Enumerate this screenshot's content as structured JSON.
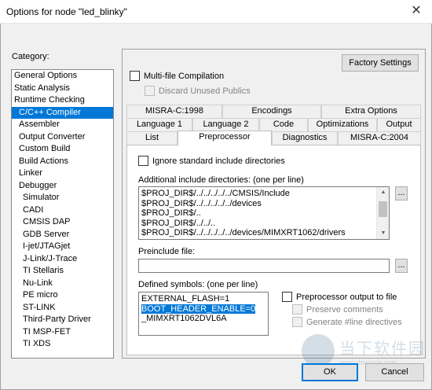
{
  "window": {
    "title": "Options for node \"led_blinky\"",
    "close_glyph": "✕"
  },
  "category": {
    "label": "Category:",
    "items": [
      {
        "label": "General Options"
      },
      {
        "label": "Static Analysis"
      },
      {
        "label": "Runtime Checking"
      },
      {
        "label": "C/C++ Compiler"
      },
      {
        "label": "Assembler"
      },
      {
        "label": "Output Converter"
      },
      {
        "label": "Custom Build"
      },
      {
        "label": "Build Actions"
      },
      {
        "label": "Linker"
      },
      {
        "label": "Debugger"
      },
      {
        "label": "Simulator"
      },
      {
        "label": "CADI"
      },
      {
        "label": "CMSIS DAP"
      },
      {
        "label": "GDB Server"
      },
      {
        "label": "I-jet/JTAGjet"
      },
      {
        "label": "J-Link/J-Trace"
      },
      {
        "label": "TI Stellaris"
      },
      {
        "label": "Nu-Link"
      },
      {
        "label": "PE micro"
      },
      {
        "label": "ST-LINK"
      },
      {
        "label": "Third-Party Driver"
      },
      {
        "label": "TI MSP-FET"
      },
      {
        "label": "TI XDS"
      }
    ],
    "selected": "C/C++ Compiler"
  },
  "factory_settings": "Factory Settings",
  "multifile": {
    "label": "Multi-file Compilation",
    "checked": false
  },
  "discard_unused": {
    "label": "Discard Unused Publics",
    "checked": false,
    "enabled": false
  },
  "tabs": {
    "row1": [
      "MISRA-C:1998",
      "Encodings",
      "Extra Options"
    ],
    "row2": [
      "Language 1",
      "Language 2",
      "Code",
      "Optimizations",
      "Output"
    ],
    "row3": [
      "List",
      "Preprocessor",
      "Diagnostics",
      "MISRA-C:2004"
    ],
    "active": "Preprocessor"
  },
  "preprocessor": {
    "ignore_std": {
      "label": "Ignore standard include directories",
      "checked": false
    },
    "include_dirs_label": "Additional include directories: (one per line)",
    "include_dirs": [
      "$PROJ_DIR$/../../../../../CMSIS/Include",
      "$PROJ_DIR$/../../../../../devices",
      "$PROJ_DIR$/..",
      "$PROJ_DIR$/../../..",
      "$PROJ_DIR$/../../../../../devices/MIMXRT1062/drivers"
    ],
    "browse_label": "...",
    "preinclude_label": "Preinclude file:",
    "preinclude_value": "",
    "defined_label": "Defined symbols: (one per line)",
    "defined_symbols": [
      {
        "text": "EXTERNAL_FLASH=1",
        "selected": false
      },
      {
        "text": "BOOT_HEADER_ENABLE=0",
        "selected": true
      },
      {
        "text": "_MIMXRT1062DVL6A",
        "selected": false
      }
    ],
    "pp_output": {
      "label": "Preprocessor output to file",
      "checked": false
    },
    "preserve_comments": {
      "label": "Preserve comments",
      "checked": false,
      "enabled": false
    },
    "gen_line": {
      "label": "Generate #line directives",
      "checked": false,
      "enabled": false
    }
  },
  "buttons": {
    "ok": "OK",
    "cancel": "Cancel"
  },
  "watermark": {
    "chinese": "当下软件园",
    "url": "www.downxia.com"
  },
  "colors": {
    "accent": "#0078d7",
    "dialog_bg": "#f0f0f0"
  }
}
